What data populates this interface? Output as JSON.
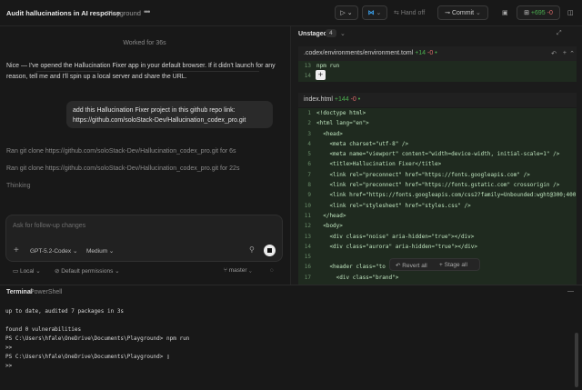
{
  "titlebar": {
    "title": "Audit hallucinations in AI response",
    "project": "Playground",
    "handoff": "Hand off",
    "commit": "Commit",
    "diff_add": "+695",
    "diff_del": "-0"
  },
  "chat": {
    "worked_for": "Worked for 36s",
    "assistant_msg": "Nice — I've opened the Hallucination Fixer app in your default browser. If it didn't launch for any reason, tell me and I'll spin up a local server and share the URL.",
    "user_msg": "add this Hallucination Fixer project in this github repo link: https://github.com/soloStack-Dev/Hallucination_codex_pro.git",
    "ran1_prefix": "Ran",
    "ran1_cmd": "git clone https://github.com/soloStack-Dev/Hallucination_codex_pro.git",
    "ran1_suffix": "for 6s",
    "ran2_prefix": "Ran",
    "ran2_cmd": "git clone https://github.com/soloStack-Dev/Hallucination_codex_pro.git",
    "ran2_suffix": "for 22s",
    "thinking": "Thinking"
  },
  "composer": {
    "placeholder": "Ask for follow-up changes",
    "model": "GPT-5.2-Codex",
    "effort": "Medium"
  },
  "status": {
    "env": "Local",
    "permissions": "Default permissions",
    "branch": "master"
  },
  "diff_panel": {
    "header": "Unstaged",
    "count": "4",
    "file1": {
      "name": ".codex/environments/environment.toml",
      "add": "+14",
      "del": "-0"
    },
    "file1_lines": [
      {
        "n": "13",
        "t": "npm run"
      },
      {
        "n": "14",
        "t": "'''"
      }
    ],
    "file2": {
      "name": "index.html",
      "add": "+144",
      "del": "-0"
    },
    "file2_lines": [
      {
        "n": "1",
        "t": "<!doctype html>"
      },
      {
        "n": "2",
        "t": "<html lang=\"en\">"
      },
      {
        "n": "3",
        "t": "  <head>"
      },
      {
        "n": "4",
        "t": "    <meta charset=\"utf-8\" />"
      },
      {
        "n": "5",
        "t": "    <meta name=\"viewport\" content=\"width=device-width, initial-scale=1\" />"
      },
      {
        "n": "6",
        "t": "    <title>Hallucination Fixer</title>"
      },
      {
        "n": "7",
        "t": "    <link rel=\"preconnect\" href=\"https://fonts.googleapis.com\" />"
      },
      {
        "n": "8",
        "t": "    <link rel=\"preconnect\" href=\"https://fonts.gstatic.com\" crossorigin />"
      },
      {
        "n": "9",
        "t": "    <link href=\"https://fonts.googleapis.com/css2?family=Unbounded:wght@300;400"
      },
      {
        "n": "10",
        "t": "    <link rel=\"stylesheet\" href=\"styles.css\" />"
      },
      {
        "n": "11",
        "t": "  </head>"
      },
      {
        "n": "12",
        "t": "  <body>"
      },
      {
        "n": "13",
        "t": "    <div class=\"noise\" aria-hidden=\"true\"></div>"
      },
      {
        "n": "14",
        "t": "    <div class=\"aurora\" aria-hidden=\"true\"></div>"
      },
      {
        "n": "15",
        "t": ""
      },
      {
        "n": "16",
        "t": "    <header class=\"to"
      },
      {
        "n": "17",
        "t": "      <div class=\"brand\">"
      }
    ],
    "revert_all": "Revert all",
    "stage_all": "Stage all"
  },
  "terminal": {
    "title": "Terminal",
    "shell": "PowerShell",
    "lines": "up to date, audited 7 packages in 3s\n\nfound 0 vulnerabilities\nPS C:\\Users\\hfale\\OneDrive\\Documents\\Playground> npm run\n>>\nPS C:\\Users\\hfale\\OneDrive\\Documents\\Playground> ▯\n>>"
  }
}
